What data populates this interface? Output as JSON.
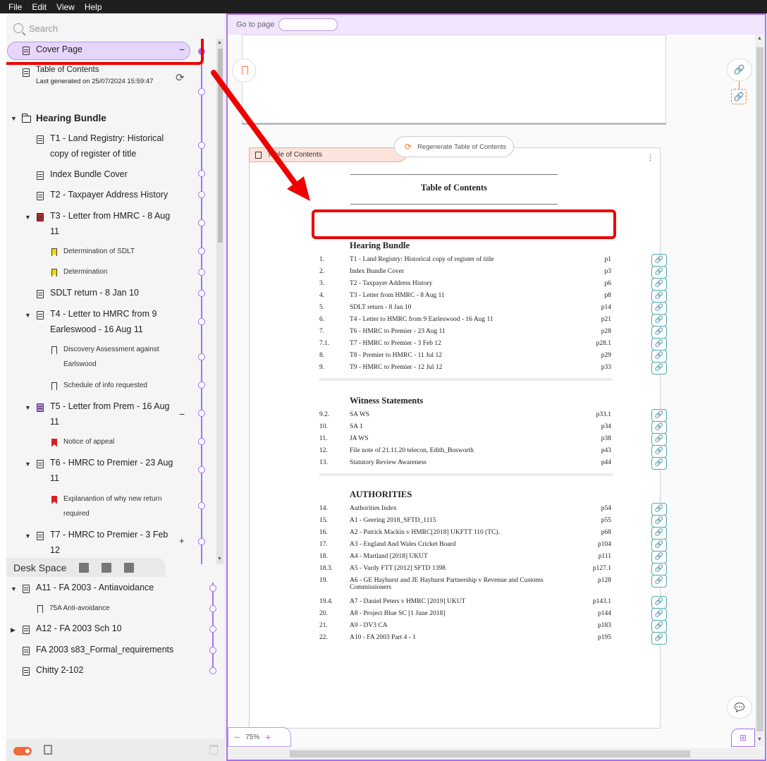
{
  "menu": [
    "File",
    "Edit",
    "View",
    "Help"
  ],
  "sidebar": {
    "search_placeholder": "Search",
    "cover_page": "Cover Page",
    "toc_label": "Table of Contents",
    "toc_generated": "Last generated on 25/07/2024 15:59:47",
    "bundle_title": "Hearing Bundle",
    "items": [
      {
        "label": "T1 - Land Registry: Historical",
        "label2": "copy of register of title"
      },
      {
        "label": "Index Bundle Cover"
      },
      {
        "label": "T2 - Taxpayer Address History"
      },
      {
        "label": "T3 - Letter from HMRC - 8 Aug",
        "label2": "11"
      },
      {
        "label": "Determination of SDLT"
      },
      {
        "label": "Determination"
      },
      {
        "label": "SDLT return - 8 Jan 10"
      },
      {
        "label": "T4 - Letter to HMRC from 9",
        "label2": "Earleswood - 16 Aug 11"
      },
      {
        "label": "Discovery Assessment against",
        "label2": "Earlswood"
      },
      {
        "label": "Schedule of info requested"
      },
      {
        "label": "T5 - Letter from Prem - 16 Aug",
        "label2": "11"
      },
      {
        "label": "Notice of appeal"
      },
      {
        "label": "T6 - HMRC to Premier - 23 Aug",
        "label2": "11"
      },
      {
        "label": "Explanantion of why new return",
        "label2": "required"
      },
      {
        "label": "T7 - HMRC to Premier - 3 Feb",
        "label2": "12"
      }
    ]
  },
  "desk": {
    "tab_label": "Desk Space",
    "items": [
      {
        "label": "A11 - FA 2003 - Antiavoidance"
      },
      {
        "label": "75A Anti-avoidance"
      },
      {
        "label": "A12 - FA 2003 Sch 10"
      },
      {
        "label": "FA 2003 s83_Formal_requirements"
      },
      {
        "label": "Chitty 2-102"
      }
    ]
  },
  "viewer": {
    "goto_label": "Go to page",
    "regen_label": "Regenerate Table of Contents",
    "toc_tab": "Table of Contents",
    "toc_title": "Table of Contents",
    "zoom": "75%",
    "sections": [
      {
        "title": "Hearing Bundle",
        "rows": [
          {
            "n": "1.",
            "t": "T1 - Land Registry: Historical copy of register of title",
            "p": "p1"
          },
          {
            "n": "2.",
            "t": "Index Bundle Cover",
            "p": "p3"
          },
          {
            "n": "3.",
            "t": "T2 - Taxpayer Address History",
            "p": "p6"
          },
          {
            "n": "4.",
            "t": "T3 - Letter from HMRC - 8 Aug 11",
            "p": "p8"
          },
          {
            "n": "5.",
            "t": "SDLT return - 8 Jan 10",
            "p": "p14"
          },
          {
            "n": "6.",
            "t": "T4 - Letter to HMRC from 9 Earleswood - 16 Aug 11",
            "p": "p21"
          },
          {
            "n": "7.",
            "t": "T6 - HMRC to Premier - 23 Aug 11",
            "p": "p28"
          },
          {
            "n": "7.1.",
            "t": "T7 - HMRC to Premier - 3 Feb 12",
            "p": "p28.1"
          },
          {
            "n": "8.",
            "t": "T8 - Premier to HMRC - 11 Jul 12",
            "p": "p29"
          },
          {
            "n": "9.",
            "t": "T9 - HMRC to Premier - 12 Jul 12",
            "p": "p33"
          }
        ]
      },
      {
        "title": "Witness Statements",
        "rows": [
          {
            "n": "9.2.",
            "t": "SA WS",
            "p": "p33.1"
          },
          {
            "n": "10.",
            "t": "SA 1",
            "p": "p34"
          },
          {
            "n": "11.",
            "t": "JA WS",
            "p": "p38"
          },
          {
            "n": "12.",
            "t": "File note of 21.11.20 telecon, Edith_Bosworth",
            "p": "p43"
          },
          {
            "n": "13.",
            "t": "Statutory Review Awareness",
            "p": "p44"
          }
        ]
      },
      {
        "title": "AUTHORITIES",
        "rows": [
          {
            "n": "14.",
            "t": "Authorities Index",
            "p": "p54"
          },
          {
            "n": "15.",
            "t": "A1 - Geering 2018_SFTD_1115",
            "p": "p55"
          },
          {
            "n": "16.",
            "t": "A2 - Patrick Mackin v HMRC[2018] UKFTT 110 (TC).",
            "p": "p68"
          },
          {
            "n": "17.",
            "t": "A3 - England And Wales Cricket Board",
            "p": "p104"
          },
          {
            "n": "18.",
            "t": "A4 - Martland [2018] UKUT",
            "p": "p111"
          },
          {
            "n": "18.3.",
            "t": "A5 - Vardy FTT [2012] SFTD 1398",
            "p": "p127.1"
          },
          {
            "n": "19.",
            "t": "A6 - GE Hayhurst and JE Hayhurst Partnership v Revenue and Customs Commissioners",
            "p": "p128"
          },
          {
            "n": "19.4.",
            "t": "A7 - Daniel Peters v HMRC [2019] UKUT",
            "p": "p143.1"
          },
          {
            "n": "20.",
            "t": "A8 - Project Blue SC [1 June 2018]",
            "p": "p144"
          },
          {
            "n": "21.",
            "t": "A9 - DV3 CA",
            "p": "p183"
          },
          {
            "n": "22.",
            "t": "A10 - FA 2003 Part 4 - 1",
            "p": "p195"
          }
        ]
      }
    ]
  }
}
